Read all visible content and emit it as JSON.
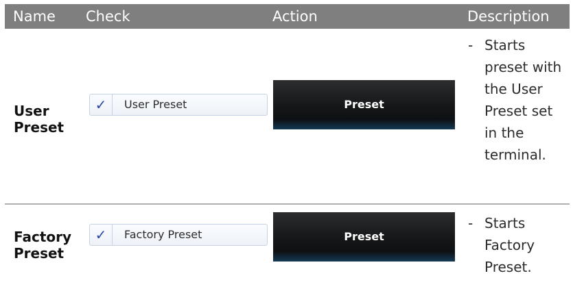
{
  "header": {
    "name": "Name",
    "check": "Check",
    "action": "Action",
    "description": "Description"
  },
  "rows": [
    {
      "name": "User Preset",
      "check_label": "User Preset",
      "checked": true,
      "action_label": "Preset",
      "description_prefix": "-",
      "description": "Starts preset with the User Preset set in the terminal."
    },
    {
      "name": "Factory Preset",
      "check_label": "Factory Preset",
      "checked": true,
      "action_label": "Preset",
      "description_prefix": "-",
      "description": "Starts Factory Preset."
    }
  ],
  "icons": {
    "check": "checkmark-icon",
    "check_glyph": "✓"
  },
  "colors": {
    "header_bg": "#7f7f7f",
    "button_bg": "#151617",
    "check_accent": "#2a45a8"
  }
}
